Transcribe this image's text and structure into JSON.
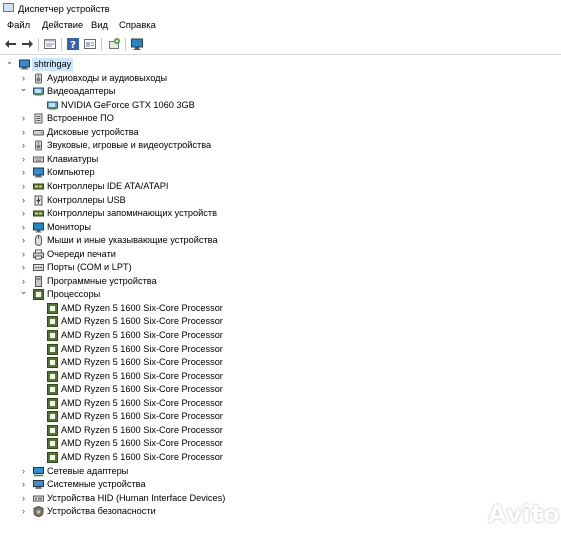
{
  "window": {
    "title": "Диспетчер устройств",
    "icon": "device-manager-icon"
  },
  "menu": [
    {
      "label": "Файл"
    },
    {
      "label": "Действие"
    },
    {
      "label": "Вид"
    },
    {
      "label": "Справка"
    }
  ],
  "toolbar": [
    {
      "icon": "back-arrow-icon"
    },
    {
      "icon": "forward-arrow-icon"
    },
    {
      "icon": "properties-icon"
    },
    {
      "icon": "help-icon"
    },
    {
      "icon": "details-icon"
    },
    {
      "icon": "scan-hardware-icon"
    },
    {
      "icon": "monitor-icon"
    }
  ],
  "tree": {
    "root": {
      "label": "shtrihgay",
      "icon": "computer-icon",
      "expanded": true
    },
    "categories": [
      {
        "label": "Аудиовходы и аудиовыходы",
        "icon": "speaker-icon",
        "expanded": false
      },
      {
        "label": "Видеоадаптеры",
        "icon": "display-adapter-icon",
        "expanded": true,
        "children": [
          {
            "label": "NVIDIA GeForce GTX 1060 3GB",
            "icon": "display-adapter-icon"
          }
        ]
      },
      {
        "label": "Встроенное ПО",
        "icon": "firmware-icon",
        "expanded": false
      },
      {
        "label": "Дисковые устройства",
        "icon": "disk-drive-icon",
        "expanded": false
      },
      {
        "label": "Звуковые, игровые и видеоустройства",
        "icon": "sound-icon",
        "expanded": false
      },
      {
        "label": "Клавиатуры",
        "icon": "keyboard-icon",
        "expanded": false
      },
      {
        "label": "Компьютер",
        "icon": "computer-icon",
        "expanded": false
      },
      {
        "label": "Контроллеры IDE ATA/ATAPI",
        "icon": "ide-controller-icon",
        "expanded": false
      },
      {
        "label": "Контроллеры USB",
        "icon": "usb-icon",
        "expanded": false
      },
      {
        "label": "Контроллеры запоминающих устройств",
        "icon": "storage-controller-icon",
        "expanded": false
      },
      {
        "label": "Мониторы",
        "icon": "monitor-icon",
        "expanded": false
      },
      {
        "label": "Мыши и иные указывающие устройства",
        "icon": "mouse-icon",
        "expanded": false
      },
      {
        "label": "Очереди печати",
        "icon": "printer-icon",
        "expanded": false
      },
      {
        "label": "Порты (COM и LPT)",
        "icon": "port-icon",
        "expanded": false
      },
      {
        "label": "Программные устройства",
        "icon": "software-device-icon",
        "expanded": false
      },
      {
        "label": "Процессоры",
        "icon": "processor-icon",
        "expanded": true,
        "children": [
          {
            "label": "AMD Ryzen 5 1600 Six-Core Processor",
            "icon": "processor-icon"
          },
          {
            "label": "AMD Ryzen 5 1600 Six-Core Processor",
            "icon": "processor-icon"
          },
          {
            "label": "AMD Ryzen 5 1600 Six-Core Processor",
            "icon": "processor-icon"
          },
          {
            "label": "AMD Ryzen 5 1600 Six-Core Processor",
            "icon": "processor-icon"
          },
          {
            "label": "AMD Ryzen 5 1600 Six-Core Processor",
            "icon": "processor-icon"
          },
          {
            "label": "AMD Ryzen 5 1600 Six-Core Processor",
            "icon": "processor-icon"
          },
          {
            "label": "AMD Ryzen 5 1600 Six-Core Processor",
            "icon": "processor-icon"
          },
          {
            "label": "AMD Ryzen 5 1600 Six-Core Processor",
            "icon": "processor-icon"
          },
          {
            "label": "AMD Ryzen 5 1600 Six-Core Processor",
            "icon": "processor-icon"
          },
          {
            "label": "AMD Ryzen 5 1600 Six-Core Processor",
            "icon": "processor-icon"
          },
          {
            "label": "AMD Ryzen 5 1600 Six-Core Processor",
            "icon": "processor-icon"
          },
          {
            "label": "AMD Ryzen 5 1600 Six-Core Processor",
            "icon": "processor-icon"
          }
        ]
      },
      {
        "label": "Сетевые адаптеры",
        "icon": "network-adapter-icon",
        "expanded": false
      },
      {
        "label": "Системные устройства",
        "icon": "system-device-icon",
        "expanded": false
      },
      {
        "label": "Устройства HID (Human Interface Devices)",
        "icon": "hid-icon",
        "expanded": false
      },
      {
        "label": "Устройства безопасности",
        "icon": "security-device-icon",
        "expanded": false
      }
    ]
  },
  "watermark": {
    "text": "Avito",
    "icon": "avito-logo-icon"
  },
  "colors": {
    "selection": "#cce8ff",
    "processor": "#4f7a28",
    "monitor": "#1e88c8"
  }
}
